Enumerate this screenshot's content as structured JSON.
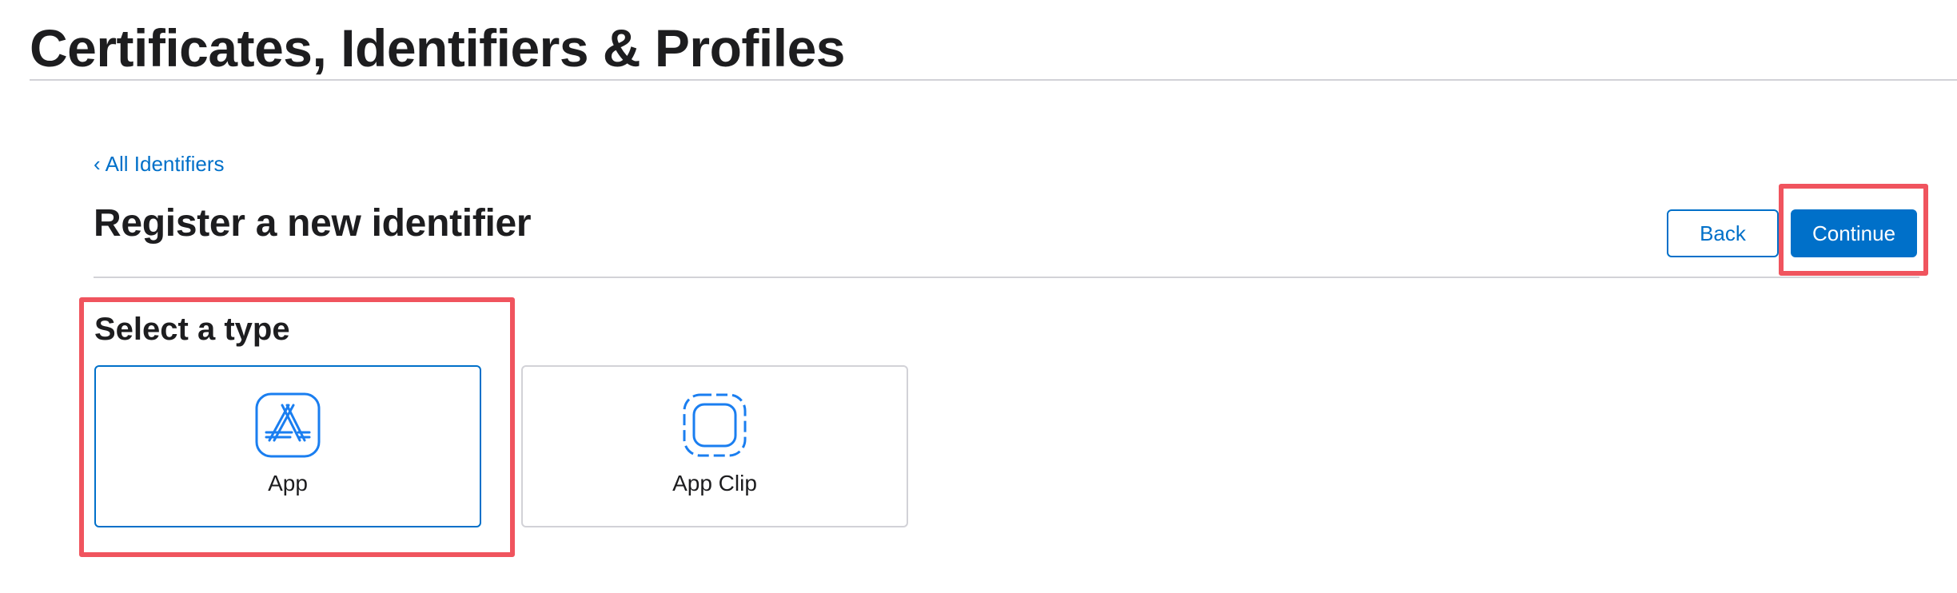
{
  "header": {
    "title": "Certificates, Identifiers & Profiles"
  },
  "nav": {
    "back_link_chevron": "‹",
    "back_link_label": "All Identifiers"
  },
  "main": {
    "page_heading": "Register a new identifier",
    "actions": {
      "back_label": "Back",
      "continue_label": "Continue"
    },
    "type_selector": {
      "title": "Select a type",
      "options": [
        {
          "label": "App",
          "icon": "app-store-icon",
          "selected": true
        },
        {
          "label": "App Clip",
          "icon": "app-clip-icon",
          "selected": false
        }
      ]
    }
  },
  "colors": {
    "accent": "#0070c9",
    "text": "#1d1d1f",
    "divider": "#d2d2d7",
    "icon": "#1a7ef0",
    "highlight": "#f0545e"
  }
}
